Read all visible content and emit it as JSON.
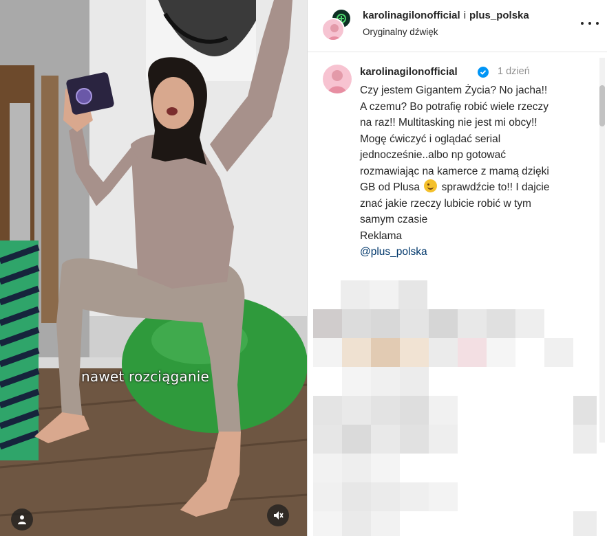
{
  "video": {
    "caption": "nawet rozciąganie",
    "controls": {
      "profile_icon": "user-circle-icon",
      "mute_icon": "speaker-muted-icon"
    }
  },
  "post": {
    "header": {
      "author_1": "karolinagilonofficial",
      "conjunction": "i",
      "author_2": "plus_polska",
      "audio": "Oryginalny dźwięk",
      "more_icon": "more-horizontal-icon"
    },
    "comment": {
      "username": "karolinagilonofficial",
      "verified_icon": "verified-badge-icon",
      "time": "1 dzień",
      "lines": [
        "Czy jestem Gigantem Życia? No jacha!!",
        "A czemu? Bo potrafię robić wiele rzeczy",
        "na raz!! Multitasking nie jest mi obcy!!",
        "Mogę ćwiczyć i oglądać serial",
        "jednocześnie..albo np gotować",
        "rozmawiając na kamerce z mamą dzięki"
      ],
      "line7_before_emoji": "GB od Plusa",
      "emoji": "winking-face-emoji",
      "line7_after_emoji": "sprawdźcie to!! I dajcie",
      "line8": "znać jakie rzeczy lubicie robić w tym",
      "line9": "samym czasie",
      "ad_label": "Reklama",
      "mention": "@plus_polska"
    }
  },
  "colors": {
    "text_primary": "#262626",
    "text_secondary": "#8e8e8e",
    "link": "#00376b",
    "verified": "#0095f6",
    "ball_green": "#2f9a3c"
  }
}
